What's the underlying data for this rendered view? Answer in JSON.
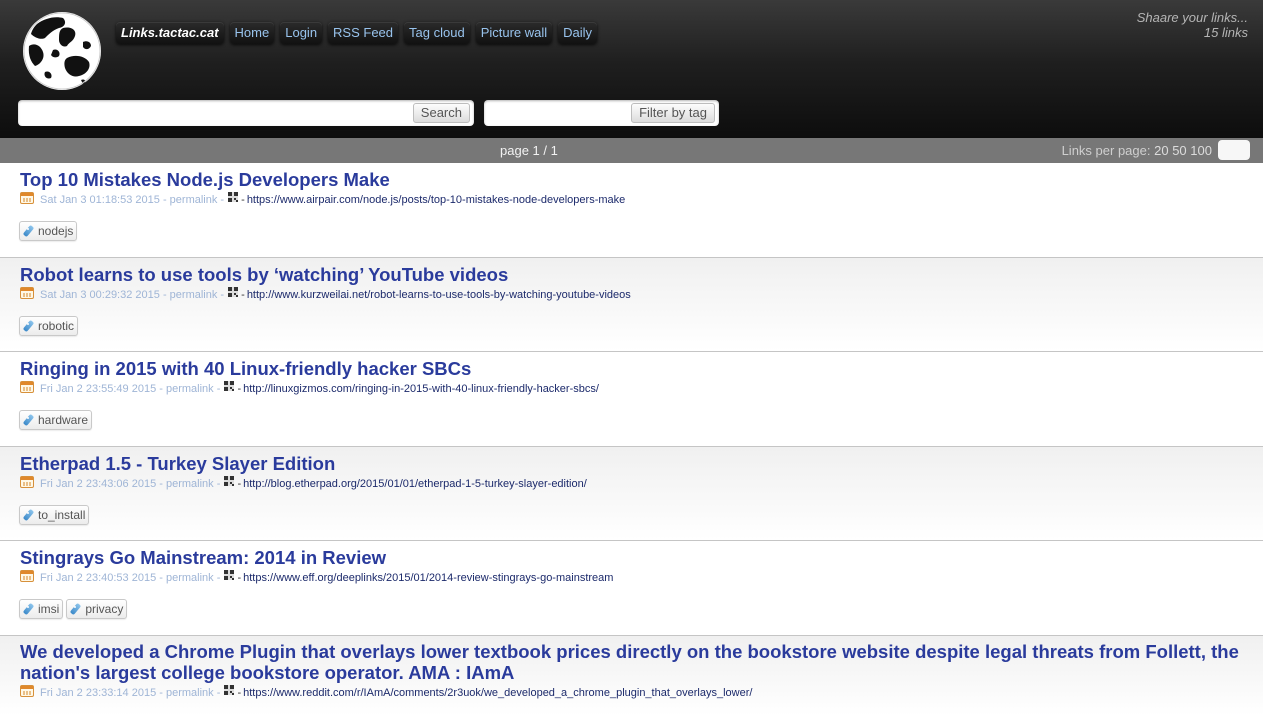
{
  "nav": {
    "brand": "Links.tactac.cat",
    "items": [
      "Home",
      "Login",
      "RSS Feed",
      "Tag cloud",
      "Picture wall",
      "Daily"
    ]
  },
  "tagline": {
    "line1": "Shaare your links...",
    "line2": "15 links"
  },
  "search": {
    "value": "",
    "button": "Search"
  },
  "tag_filter": {
    "value": "",
    "button": "Filter by tag"
  },
  "pagination": {
    "status": "page 1 / 1",
    "per_page_label": "Links per page:",
    "per_page_options": [
      "20",
      "50",
      "100"
    ]
  },
  "links": [
    {
      "title": "Top 10 Mistakes Node.js Developers Make",
      "date": "Sat Jan 3 01:18:53 2015",
      "permalink": "permalink",
      "url": "https://www.airpair.com/node.js/posts/top-10-mistakes-node-developers-make",
      "tags": [
        "nodejs"
      ]
    },
    {
      "title": "Robot learns to use tools by ‘watching’ YouTube videos",
      "date": "Sat Jan 3 00:29:32 2015",
      "permalink": "permalink",
      "url": "http://www.kurzweilai.net/robot-learns-to-use-tools-by-watching-youtube-videos",
      "tags": [
        "robotic"
      ]
    },
    {
      "title": "Ringing in 2015 with 40 Linux-friendly hacker SBCs",
      "date": "Fri Jan 2 23:55:49 2015",
      "permalink": "permalink",
      "url": "http://linuxgizmos.com/ringing-in-2015-with-40-linux-friendly-hacker-sbcs/",
      "tags": [
        "hardware"
      ]
    },
    {
      "title": "Etherpad 1.5 - Turkey Slayer Edition",
      "date": "Fri Jan 2 23:43:06 2015",
      "permalink": "permalink",
      "url": "http://blog.etherpad.org/2015/01/01/etherpad-1-5-turkey-slayer-edition/",
      "tags": [
        "to_install"
      ]
    },
    {
      "title": "Stingrays Go Mainstream: 2014 in Review",
      "date": "Fri Jan 2 23:40:53 2015",
      "permalink": "permalink",
      "url": "https://www.eff.org/deeplinks/2015/01/2014-review-stingrays-go-mainstream",
      "tags": [
        "imsi",
        "privacy"
      ]
    },
    {
      "title": "We developed a Chrome Plugin that overlays lower textbook prices directly on the bookstore website despite legal threats from Follett, the nation's largest college bookstore operator. AMA : IAmA",
      "date": "Fri Jan 2 23:33:14 2015",
      "permalink": "permalink",
      "url": "https://www.reddit.com/r/IAmA/comments/2r3uok/we_developed_a_chrome_plugin_that_overlays_lower/",
      "tags": []
    }
  ]
}
